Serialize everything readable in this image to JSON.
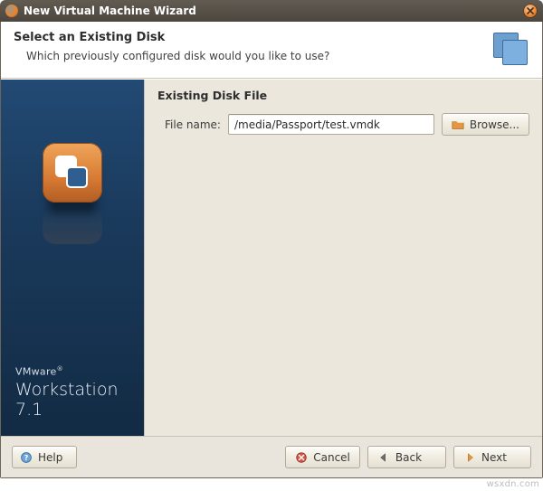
{
  "window": {
    "title": "New Virtual Machine Wizard"
  },
  "header": {
    "title": "Select an Existing Disk",
    "subtitle": "Which previously configured disk would you like to use?"
  },
  "section": {
    "title": "Existing Disk File",
    "file_label": "File name:",
    "file_value": "/media/Passport/test.vmdk",
    "browse_label": "Browse..."
  },
  "sidebar": {
    "brand": "VMware",
    "brand_mark": "®",
    "product": "Workstation 7.1"
  },
  "footer": {
    "help_label": "Help",
    "cancel_label": "Cancel",
    "back_label": "Back",
    "next_label": "Next"
  },
  "watermark": "wsxdn.com"
}
